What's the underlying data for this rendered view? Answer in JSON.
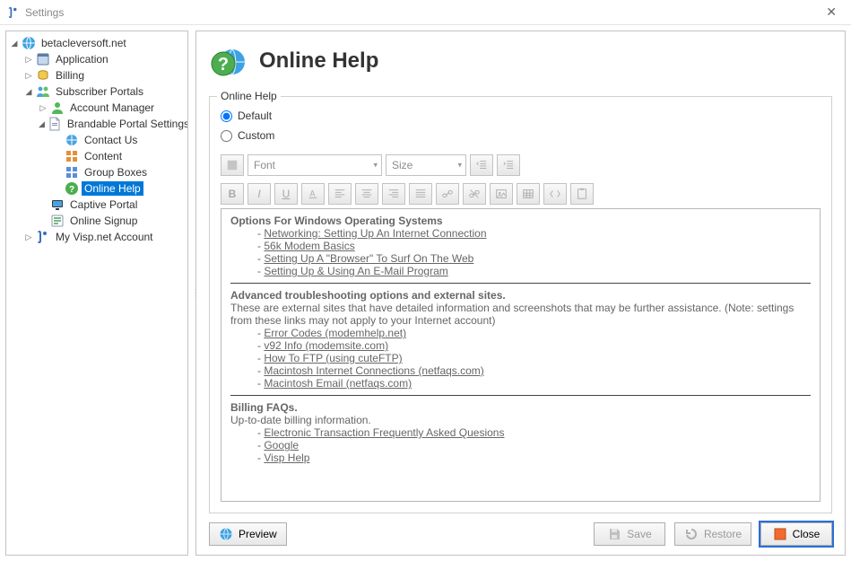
{
  "window": {
    "title": "Settings",
    "close_symbol": "✕"
  },
  "tree": {
    "root": "betacleversoft.net",
    "application": "Application",
    "billing": "Billing",
    "subscriber_portals": "Subscriber Portals",
    "account_manager": "Account Manager",
    "brandable_portal_settings": "Brandable Portal Settings",
    "contact_us": "Contact Us",
    "content": "Content",
    "group_boxes": "Group Boxes",
    "online_help": "Online Help",
    "captive_portal": "Captive Portal",
    "online_signup": "Online Signup",
    "my_visp": "My Visp.net Account"
  },
  "page_title": "Online Help",
  "group_label": "Online Help",
  "radio": {
    "default": "Default",
    "custom": "Custom"
  },
  "toolbar": {
    "font_label": "Font",
    "size_label": "Size"
  },
  "content": {
    "sect1_title": "Options For Windows Operating Systems",
    "sect1_l1": "Networking: Setting Up An Internet Connection",
    "sect1_l2": "56k Modem Basics",
    "sect1_l3": "Setting Up A \"Browser\" To Surf On The Web",
    "sect1_l4": "Setting Up & Using An E-Mail Program",
    "sect2_title": "Advanced troubleshooting options and external sites.",
    "sect2_desc": "These are external sites that have detailed information and screenshots that may be further assistance. (Note: settings from these links may not apply to your Internet account)",
    "sect2_l1": "Error Codes (modemhelp.net)",
    "sect2_l2": "v92 Info (modemsite.com)",
    "sect2_l3": "How To FTP (using cuteFTP)",
    "sect2_l4": "Macintosh Internet Connections (netfaqs.com)",
    "sect2_l5": "Macintosh Email (netfaqs.com)",
    "sect3_title": "Billing FAQs.",
    "sect3_desc": "Up-to-date billing information.",
    "sect3_l1": "Electronic Transaction Frequently Asked Quesions ",
    "sect3_l2": "Google ",
    "sect3_l3": "Visp Help"
  },
  "buttons": {
    "preview": "Preview",
    "save": "Save",
    "restore": "Restore",
    "close": "Close"
  }
}
